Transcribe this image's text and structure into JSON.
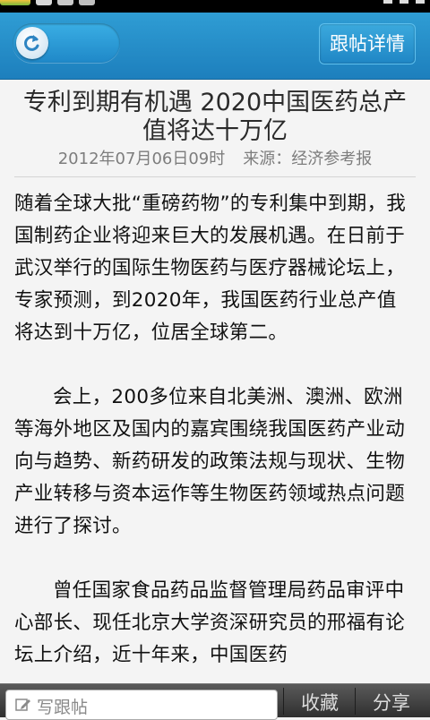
{
  "header": {
    "back_icon": "refresh-arrow-icon",
    "detail_button": "跟帖详情"
  },
  "article": {
    "title": "专利到期有机遇 2020中国医药总产值将达十万亿",
    "date": "2012年07月06日09时",
    "source": "来源：经济参考报",
    "paragraphs": [
      "随着全球大批“重磅药物”的专利集中到期，我国制药企业将迎来巨大的发展机遇。在日前于武汉举行的国际生物医药与医疗器械论坛上，专家预测，到2020年，我国医药行业总产值将达到十万亿，位居全球第二。",
      "会上，200多位来自北美洲、澳洲、欧洲等海外地区及国内的嘉宾围绕我国医药产业动向与趋势、新药研发的政策法规与现状、生物产业转移与资本运作等生物医药领域热点问题进行了探讨。",
      "曾任国家食品药品监督管理局药品审评中心部长、现任北京大学资深研究员的邢福有论坛上介绍，近十年来，中国医药"
    ]
  },
  "bottombar": {
    "write_placeholder": "写跟帖",
    "favorite_label": "收藏",
    "share_label": "分享"
  },
  "colors": {
    "header_blue": "#2f9dd4",
    "background": "#f4f4f4",
    "bottom_bar": "#3a3a3a"
  }
}
